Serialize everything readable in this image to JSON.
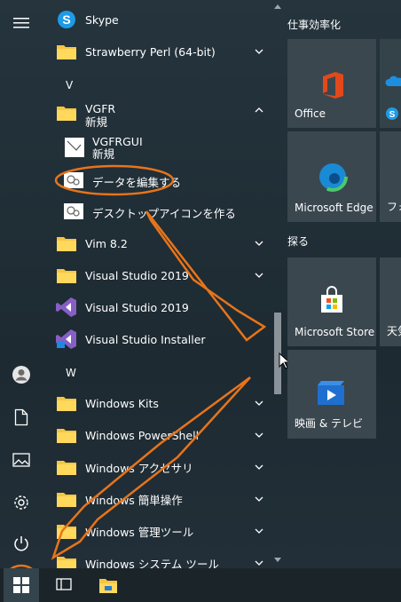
{
  "apps": {
    "skype": "Skype",
    "strawberry": "Strawberry Perl (64-bit)",
    "letter_v": "V",
    "vgfr": "VGFR",
    "vgfr_sub": "新規",
    "vgfrgui": "VGFRGUI",
    "vgfrgui_sub": "新規",
    "edit_data": "データを編集する",
    "desktop_icon": "デスクトップアイコンを作る",
    "vim": "Vim 8.2",
    "vs2019_folder": "Visual Studio 2019",
    "vs2019_app": "Visual Studio 2019",
    "vs_installer": "Visual Studio Installer",
    "letter_w": "W",
    "win_kits": "Windows Kits",
    "win_powershell": "Windows PowerShell",
    "win_accessories": "Windows アクセサリ",
    "win_ease": "Windows 簡単操作",
    "win_admin": "Windows 管理ツール",
    "win_system": "Windows システム ツール"
  },
  "tiles": {
    "group1": "仕事効率化",
    "office": "Office",
    "edge": "Microsoft Edge",
    "photo_partial": "フォ",
    "group2": "探る",
    "store": "Microsoft Store",
    "weather_partial": "天気",
    "movies": "映画 & テレビ"
  },
  "colors": {
    "accent_annotation": "#e8741a",
    "folder_yellow": "#f5c542",
    "tile_bg": "#3a474f"
  }
}
